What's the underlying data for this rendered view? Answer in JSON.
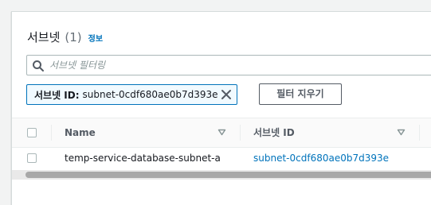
{
  "header": {
    "title": "서브넷",
    "count": "(1)",
    "info_link": "정보"
  },
  "search": {
    "placeholder": "서브넷 필터링",
    "value": ""
  },
  "filter_token": {
    "label": "서브넷 ID:",
    "value": "subnet-0cdf680ae0b7d393e"
  },
  "clear_filters_label": "필터 지우기",
  "table": {
    "columns": [
      "Name",
      "서브넷 ID"
    ],
    "rows": [
      {
        "name": "temp-service-database-subnet-a",
        "subnet_id": "subnet-0cdf680ae0b7d393e"
      }
    ]
  },
  "icons": {
    "search": "search-icon",
    "dismiss": "close-icon",
    "sort": "caret-down-icon"
  },
  "colors": {
    "accent": "#0073bb",
    "token_bg": "#f1faff",
    "page_bg": "#f2f3f3"
  }
}
